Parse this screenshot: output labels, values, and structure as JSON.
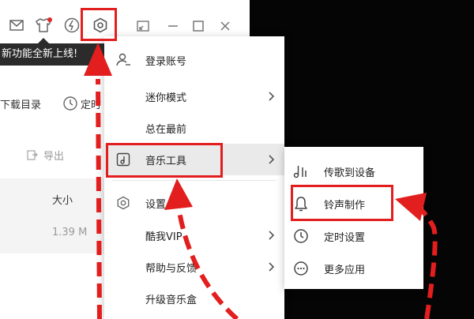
{
  "tooltip": {
    "text": "新功能全新上线!"
  },
  "toolbar": {
    "icons": [
      "mail-icon",
      "tshirt-icon",
      "lightning-icon",
      "settings-hexagon-icon",
      "miniplayer-icon",
      "minimize-icon",
      "maximize-icon",
      "close-icon"
    ]
  },
  "left_panel": {
    "download_dir": "下载目录",
    "timer": "定时",
    "export": "导出",
    "col_size": "大小",
    "size_value": "1.39 M"
  },
  "menu": {
    "items": [
      {
        "label": "登录账号",
        "icon": "user-login-icon",
        "submenu": false
      },
      {
        "label": "迷你模式",
        "icon": "",
        "submenu": true
      },
      {
        "label": "总在最前",
        "icon": "",
        "submenu": false
      },
      {
        "label": "音乐工具",
        "icon": "music-tool-icon",
        "submenu": true,
        "active": true
      },
      {
        "label": "设置",
        "icon": "settings-icon",
        "submenu": false
      },
      {
        "label": "酷我VIP",
        "icon": "",
        "submenu": true
      },
      {
        "label": "帮助与反馈",
        "icon": "",
        "submenu": true
      },
      {
        "label": "升级音乐盒",
        "icon": "",
        "submenu": false
      }
    ]
  },
  "submenu": {
    "items": [
      {
        "label": "传歌到设备",
        "icon": "music-note-transfer-icon"
      },
      {
        "label": "铃声制作",
        "icon": "bell-icon",
        "highlighted": true
      },
      {
        "label": "定时设置",
        "icon": "clock-icon"
      },
      {
        "label": "更多应用",
        "icon": "more-apps-icon"
      }
    ]
  },
  "colors": {
    "highlight": "#e21e1e",
    "tooltip_bg": "#2b2b2b"
  }
}
